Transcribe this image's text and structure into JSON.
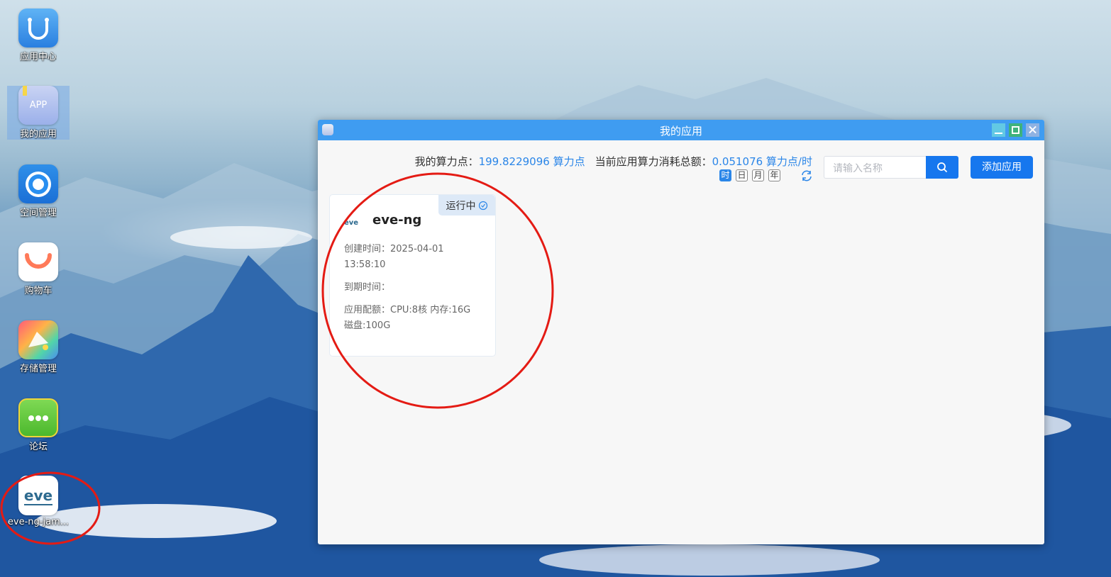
{
  "desktop": {
    "icons": [
      {
        "label": "应用中心",
        "icon": "shopping-bag-icon"
      },
      {
        "label": "我的应用",
        "icon": "app-icon",
        "badge_text": "APP"
      },
      {
        "label": "空间管理",
        "icon": "browser-circle-icon"
      },
      {
        "label": "购物车",
        "icon": "cart-smile-icon"
      },
      {
        "label": "存储管理",
        "icon": "storage-folder-icon"
      },
      {
        "label": "论坛",
        "icon": "chat-bubble-icon"
      },
      {
        "label": "eve-ng-jam...",
        "icon": "eve-logo-icon",
        "logo_text": "eve"
      }
    ]
  },
  "window": {
    "title": "我的应用",
    "stats": {
      "points_label": "我的算力点：",
      "points_value": "199.8229096 算力点",
      "consume_label": "当前应用算力消耗总额：",
      "consume_value": "0.051076 算力点/时"
    },
    "periods": [
      "时",
      "日",
      "月",
      "年"
    ],
    "active_period": "时",
    "search": {
      "placeholder": "请输入名称"
    },
    "add_button": "添加应用",
    "apps": [
      {
        "status": "运行中",
        "logo_text": "eve",
        "name": "eve-ng",
        "created_line1": "创建时间：2025-04-01",
        "created_line2": "13:58:10",
        "expire": "到期时间：",
        "spec_line1": "应用配额：CPU:8核 内存:16G",
        "spec_line2": "磁盘:100G"
      }
    ]
  },
  "colors": {
    "accent": "#1677ee",
    "titlebar": "#3f9cf1",
    "annotation": "#e41b14"
  }
}
